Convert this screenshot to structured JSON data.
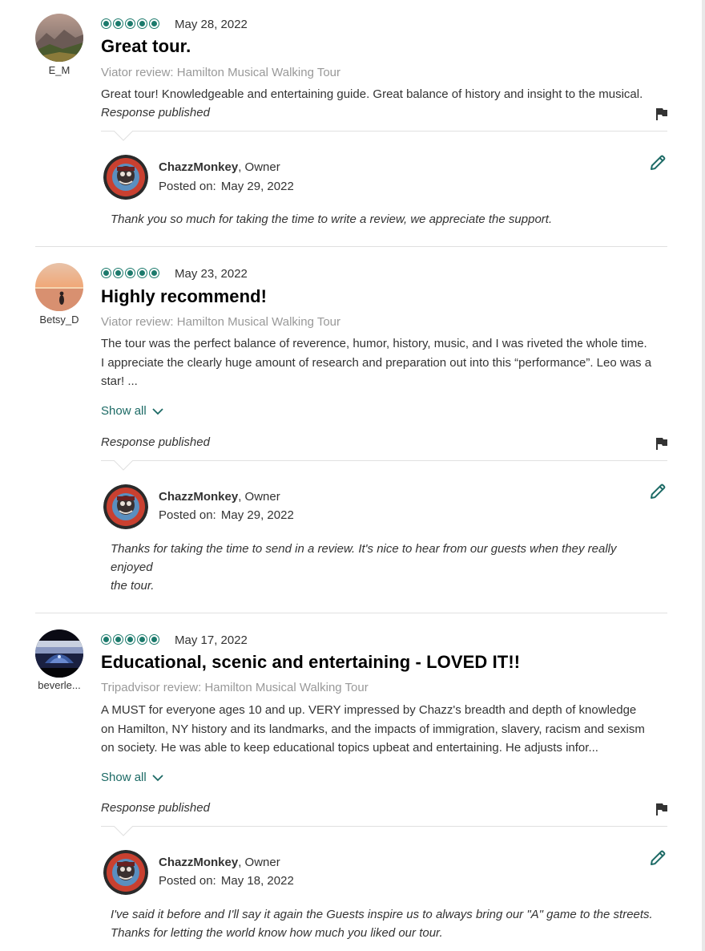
{
  "reviews": [
    {
      "username": "E_M",
      "rating": 5,
      "date": "May 28, 2022",
      "title": "Great tour.",
      "source": "Viator review: Hamilton Musical Walking Tour",
      "body": "Great tour! Knowledgeable and entertaining guide. Great balance of history and insight to the musical.",
      "show_all": "",
      "response_status": "Response published",
      "response": {
        "owner_name": "ChazzMonkey",
        "owner_role": ", Owner",
        "posted_label": "Posted on:",
        "posted_date": "May 29, 2022",
        "text": "Thank you so much for taking the time to write a review, we appreciate the support."
      }
    },
    {
      "username": "Betsy_D",
      "rating": 5,
      "date": "May 23, 2022",
      "title": "Highly recommend!",
      "source": "Viator review: Hamilton Musical Walking Tour",
      "body_lines": [
        "The tour was the perfect balance of reverence, humor, history, music, and I was riveted the whole time.",
        "I appreciate the clearly huge amount of research and preparation out into this “performance”. Leo was a",
        "star! ..."
      ],
      "show_all": "Show all",
      "response_status": "Response published",
      "response": {
        "owner_name": "ChazzMonkey",
        "owner_role": ", Owner",
        "posted_label": "Posted on:",
        "posted_date": "May 29, 2022",
        "text_lines": [
          "Thanks for taking the time to send in a review. It's nice to hear from our guests when they really",
          "enjoyed",
          "the tour."
        ]
      }
    },
    {
      "username": "beverle...",
      "rating": 5,
      "date": "May 17, 2022",
      "title": "Educational, scenic and entertaining - LOVED IT!!",
      "source": "Tripadvisor review: Hamilton Musical Walking Tour",
      "body_lines": [
        "A MUST for everyone ages 10 and up. VERY impressed by Chazz's breadth and depth of knowledge",
        "on Hamilton, NY history and its landmarks, and the impacts of immigration, slavery, racism and sexism",
        "on society. He was able to keep educational topics upbeat and entertaining. He adjusts infor..."
      ],
      "show_all": "Show all",
      "response_status": "Response published",
      "response": {
        "owner_name": "ChazzMonkey",
        "owner_role": ", Owner",
        "posted_label": "Posted on:",
        "posted_date": "May 18, 2022",
        "text_lines": [
          "I've said it before and I'll say it again the Guests inspire us to always bring our \"A\" game to the streets.",
          "Thanks for letting the world know how much you liked our tour."
        ]
      }
    }
  ],
  "icons": {
    "rating": "bubble-rating-icon",
    "flag": "flag-icon",
    "edit": "pencil-icon",
    "chevron": "chevron-down-icon"
  },
  "colors": {
    "accent": "#1c6a65",
    "rating": "#1c7a6c",
    "muted": "#999999"
  }
}
